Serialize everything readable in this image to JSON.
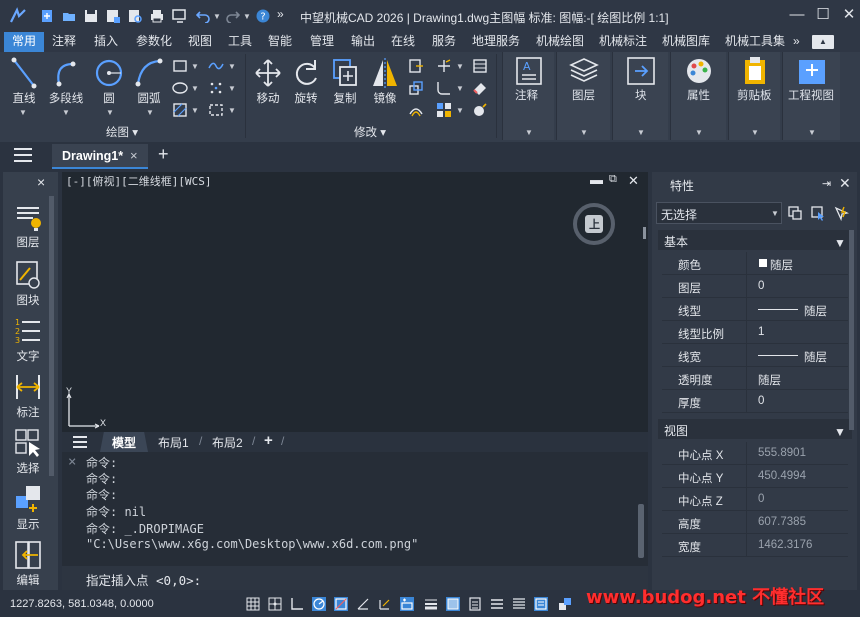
{
  "titlebar": {
    "title": "中望机械CAD 2026 | Drawing1.dwg主图幅  标准: 图幅:-[ 绘图比例 1:1]",
    "more": "»"
  },
  "menubar": {
    "tabs": [
      "常用",
      "注释",
      "插入",
      "参数化",
      "视图",
      "工具",
      "智能",
      "管理",
      "输出",
      "在线",
      "服务",
      "地理服务",
      "机械绘图",
      "机械标注",
      "机械图库",
      "机械工具集"
    ],
    "more": "»"
  },
  "ribbon": {
    "draw_tools": [
      "直线",
      "多段线",
      "圆",
      "圆弧"
    ],
    "modify_tools": [
      "移动",
      "旋转",
      "复制",
      "镜像"
    ],
    "group_draw": "绘图",
    "group_modify": "修改",
    "panels": [
      "注释",
      "图层",
      "块",
      "属性",
      "剪贴板",
      "工程视图"
    ]
  },
  "doc": {
    "tab_label": "Drawing1*",
    "close": "×",
    "new": "+"
  },
  "left_panel": {
    "close": "×",
    "tools": [
      "图层",
      "图块",
      "文字",
      "标注",
      "选择",
      "显示",
      "编辑"
    ]
  },
  "canvas": {
    "viewport_label": "[-][俯视][二维线框][WCS]",
    "viewcube_label": "上",
    "ucs_x": "X",
    "ucs_y": "Y"
  },
  "layout_tabs": {
    "tabs": [
      "模型",
      "布局1",
      "布局2"
    ],
    "add": "+"
  },
  "command": {
    "history": [
      "命令:",
      "命令:",
      "命令:",
      "命令: nil",
      "命令: _.DROPIMAGE",
      "\"C:\\Users\\www.x6g.com\\Desktop\\www.x6d.com.png\""
    ],
    "prompt": "指定插入点 <0,0>:",
    "close": "×"
  },
  "properties": {
    "title": "特性",
    "selection": "无选择",
    "section_basic": "基本",
    "basic": [
      {
        "label": "颜色",
        "value": "随层"
      },
      {
        "label": "图层",
        "value": "0"
      },
      {
        "label": "线型",
        "value": "随层"
      },
      {
        "label": "线型比例",
        "value": "1"
      },
      {
        "label": "线宽",
        "value": "随层"
      },
      {
        "label": "透明度",
        "value": "随层"
      },
      {
        "label": "厚度",
        "value": "0"
      }
    ],
    "section_view": "视图",
    "view": [
      {
        "label": "中心点 X",
        "value": "555.8901"
      },
      {
        "label": "中心点 Y",
        "value": "450.4994"
      },
      {
        "label": "中心点 Z",
        "value": "0"
      },
      {
        "label": "高度",
        "value": "607.7385"
      },
      {
        "label": "宽度",
        "value": "1462.3176"
      }
    ]
  },
  "status": {
    "coords": "1227.8263, 581.0348, 0.0000"
  },
  "watermark": "www.budog.net 不懂社区",
  "colors": {
    "accent": "#3b86d6",
    "canvas_bg": "#212830",
    "panel_bg": "#323a47",
    "watermark": "#ff2e2e"
  }
}
